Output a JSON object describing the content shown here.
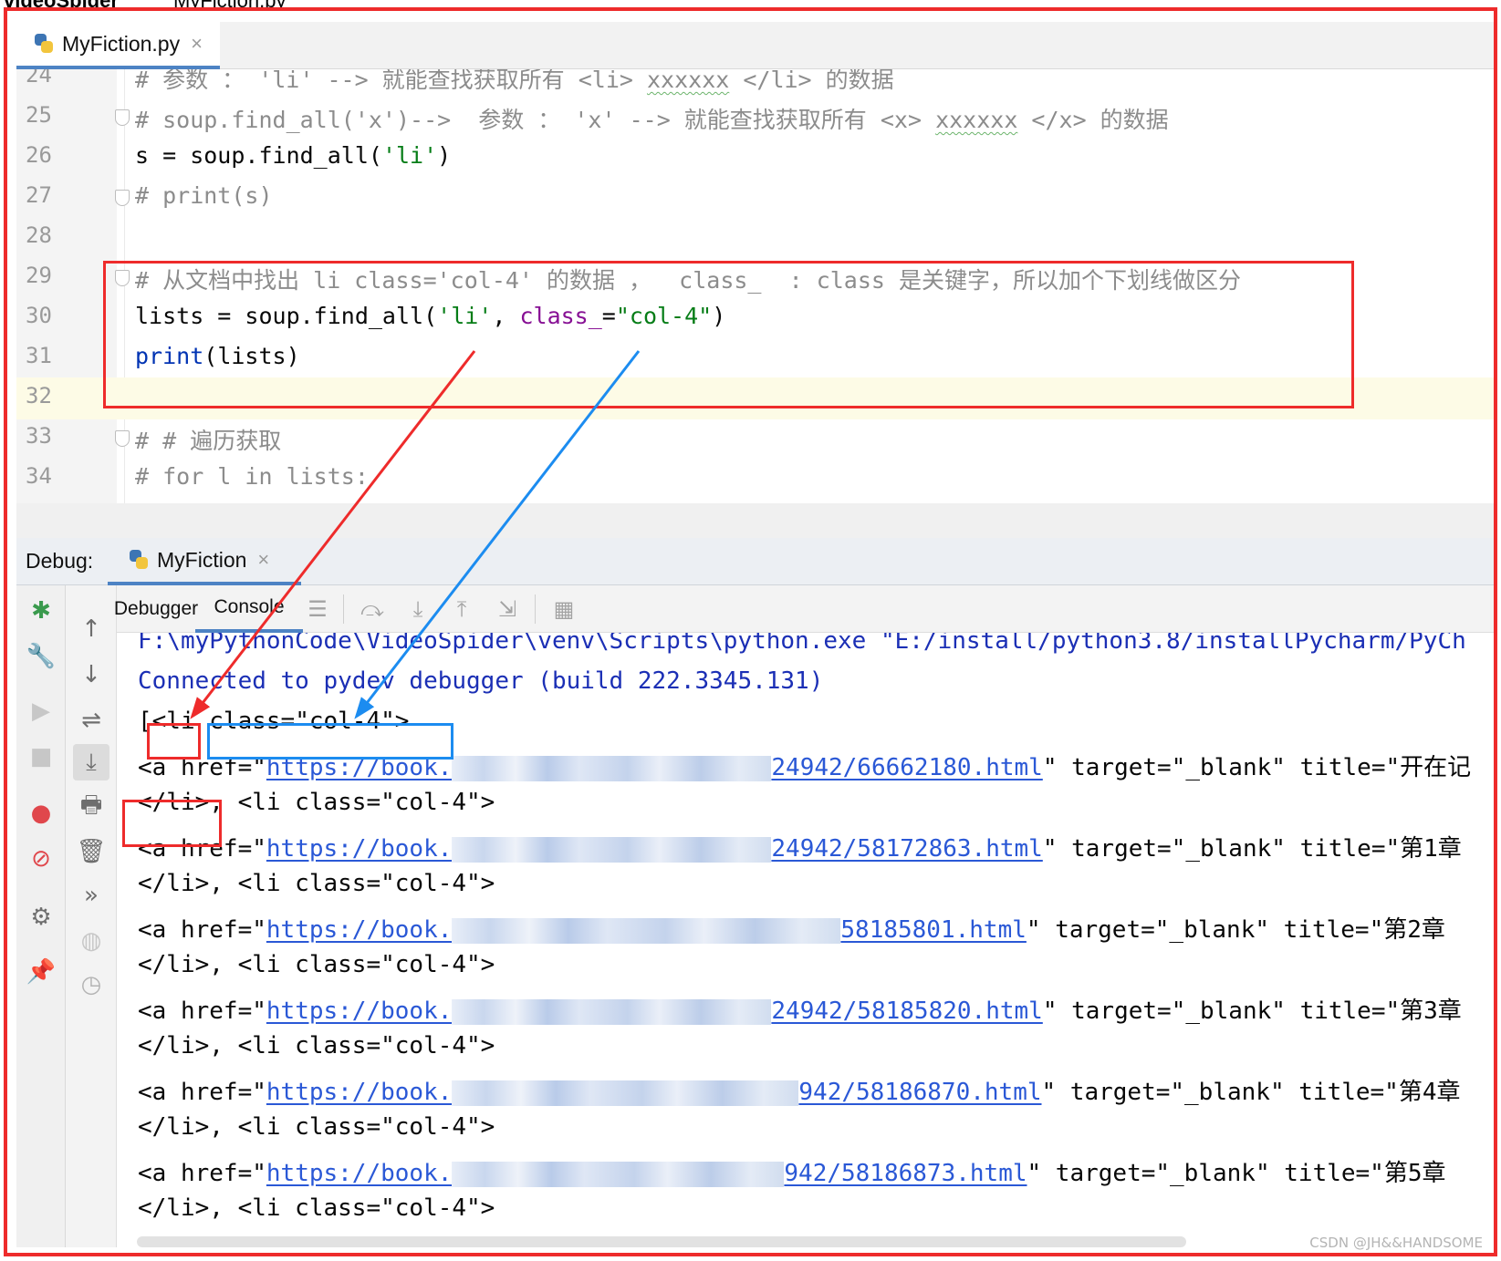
{
  "breadcrumb": {
    "project": "videoSpider",
    "file": "MyFiction.py"
  },
  "editor_tab": {
    "label": "MyFiction.py",
    "close": "×"
  },
  "editor_lines": [
    {
      "num": "24",
      "text": "# 参数 ： 'li' --> 就能查找获取所有 <li> xxxxxx </li> 的数据"
    },
    {
      "num": "25",
      "text": "# soup.find_all('x')--> 参数 ： 'x' --> 就能查找获取所有 <x> xxxxxx </x> 的数据"
    },
    {
      "num": "26",
      "text": "s = soup.find_all('li')"
    },
    {
      "num": "27",
      "text": "# print(s)"
    },
    {
      "num": "28",
      "text": ""
    },
    {
      "num": "29",
      "text": "# 从文档中找出 li class='col-4' 的数据 ，  class_  : class 是关键字，所以加个下划线做区分"
    },
    {
      "num": "30",
      "text": "lists = soup.find_all('li', class_=\"col-4\")"
    },
    {
      "num": "31",
      "text": "print(lists)"
    },
    {
      "num": "32",
      "text": ""
    },
    {
      "num": "33",
      "text": "# # 遍历获取"
    },
    {
      "num": "34",
      "text": "# for l in lists:"
    }
  ],
  "debug": {
    "label": "Debug:",
    "tab": "MyFiction",
    "close": "×",
    "subtabs": {
      "debugger": "Debugger",
      "console": "Console"
    }
  },
  "console": {
    "cmd": "F:\\myPythonCode\\VideoSpider\\venv\\Scripts\\python.exe \"E:/install/python3.8/installPycharm/PyCh",
    "connected": "Connected to pydev debugger (build 222.3345.131)",
    "first_open": "[<li",
    "first_class": " class=\"col-4\">",
    "a_prefix": "<a href=\"",
    "link_start": "https://book.",
    "close_li": "</li>, <li class=\"col-4\">",
    "rows": [
      {
        "link_end": "24942/66662180.html",
        "tail": "\" target=\"_blank\" title=\"开在记"
      },
      {
        "link_end": "24942/58172863.html",
        "tail": "\" target=\"_blank\" title=\"第1章"
      },
      {
        "link_end": "58185801.html",
        "tail": "\" target=\"_blank\" title=\"第2章"
      },
      {
        "link_end": "24942/58185820.html",
        "tail": "\" target=\"_blank\" title=\"第3章"
      },
      {
        "link_end": "942/58186870.html",
        "tail": "\" target=\"_blank\" title=\"第4章"
      },
      {
        "link_end": "942/58186873.html",
        "tail": "\" target=\"_blank\" title=\"第5章"
      }
    ],
    "last_partial": "</li>, <li class=\"col-4\">"
  },
  "watermark": "CSDN @JH&&HANDSOME",
  "colors": {
    "annotation_red": "#ee2b2b",
    "annotation_blue": "#1c8cf0",
    "tab_underline": "#4d83c4"
  }
}
